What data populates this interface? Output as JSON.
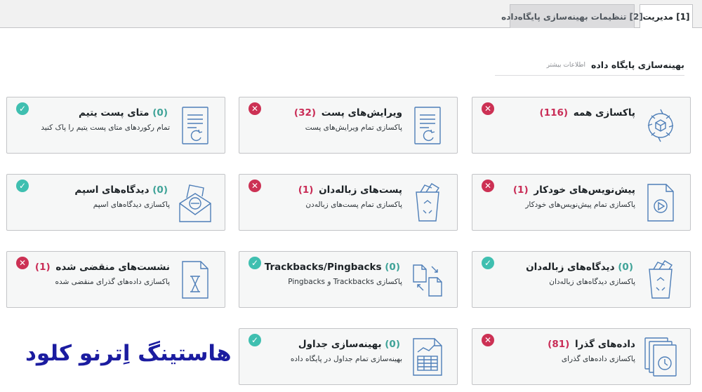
{
  "tabs": [
    {
      "label": "[1] مدیریت",
      "active": true
    },
    {
      "label": "[2] تنظیمات بهینه‌سازی پایگاه‌داده",
      "active": false
    }
  ],
  "section": {
    "title": "بهینه‌سازی پایگاه داده",
    "link": "اطلاعات بیشتر"
  },
  "cards": [
    {
      "title": "پاکسازی همه",
      "count": "(116)",
      "desc": "",
      "status": "bad",
      "icon": "gear-cube-icon"
    },
    {
      "title": "ویرایش‌های پست",
      "count": "(32)",
      "desc": "پاکسازی تمام ویرایش‌های پست",
      "status": "bad",
      "icon": "document-refresh-icon"
    },
    {
      "title": "متای پست یتیم",
      "count": "(0)",
      "desc": "تمام رکوردهای متای پست یتیم را پاک کنید",
      "status": "ok",
      "icon": "document-refresh-icon"
    },
    {
      "title": "پیش‌نویس‌های خودکار",
      "count": "(1)",
      "desc": "پاکسازی تمام پیش‌نویس‌های خودکار",
      "status": "bad",
      "icon": "document-play-icon"
    },
    {
      "title": "پست‌های زباله‌دان",
      "count": "(1)",
      "desc": "پاکسازی تمام پست‌های زباله‌دن",
      "status": "bad",
      "icon": "trash-bin-icon"
    },
    {
      "title": "دیدگاه‌های اسپم",
      "count": "(0)",
      "desc": "پاکسازی دیدگاه‌های اسپم",
      "status": "ok",
      "icon": "spam-envelope-icon"
    },
    {
      "title": "دیدگاه‌های زباله‌دان",
      "count": "(0)",
      "desc": "پاکسازی دیدگاه‌های زباله‌دان",
      "status": "ok",
      "icon": "trash-bin-icon"
    },
    {
      "title": "Trackbacks/Pingbacks",
      "count": "(0)",
      "desc": "پاکسازی Trackbacks و Pingbacks",
      "status": "ok",
      "icon": "document-exchange-icon"
    },
    {
      "title": "نشست‌های منقضی شده",
      "count": "(1)",
      "desc": "پاکسازی داده‌های گذرای منقضی شده",
      "status": "bad",
      "icon": "hourglass-document-icon"
    },
    {
      "title": "داده‌های گذرا",
      "count": "(81)",
      "desc": "پاکسازی داده‌های گذرای",
      "status": "bad",
      "icon": "clock-pages-icon"
    },
    {
      "title": "بهینه‌سازی جداول",
      "count": "(0)",
      "desc": "بهینه‌سازی تمام جداول در پایگاه داده",
      "status": "ok",
      "icon": "spreadsheet-chart-icon"
    }
  ],
  "watermark": "هاستینگ اِترنو کلود",
  "colors": {
    "ok": "#3fbfb0",
    "bad": "#cc3154",
    "icon_stroke": "#4f7fb8",
    "watermark": "#1b1ca0"
  }
}
